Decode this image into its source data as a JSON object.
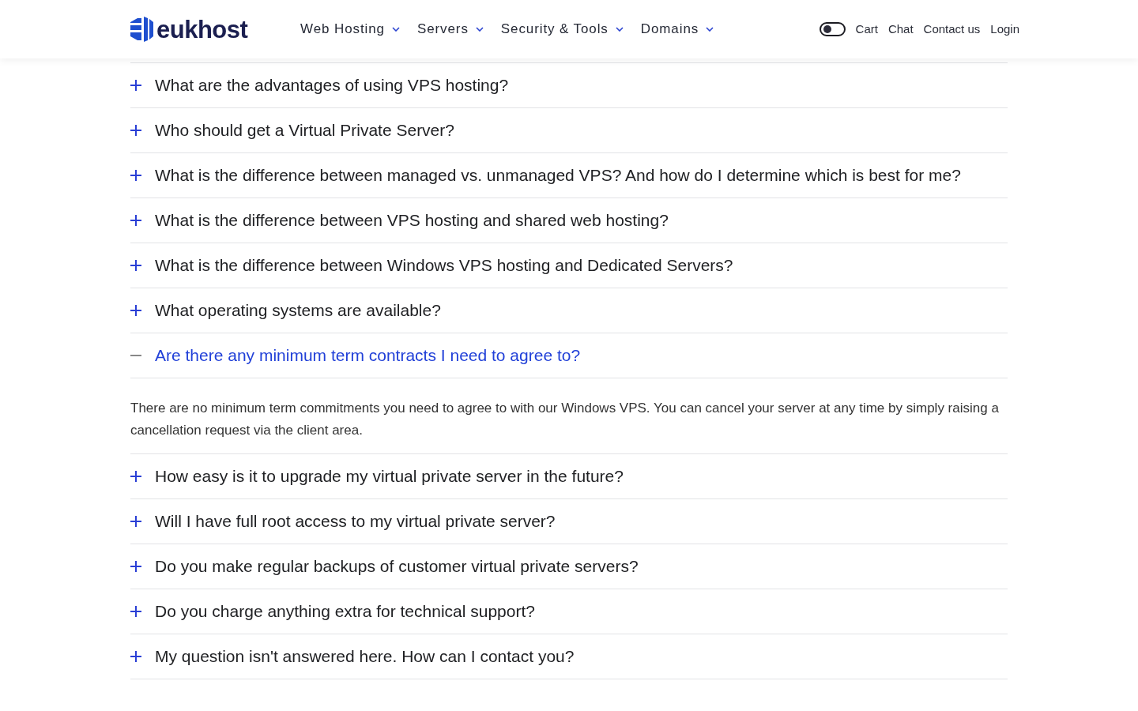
{
  "header": {
    "brand": "eukhost",
    "nav": [
      {
        "label": "Web Hosting"
      },
      {
        "label": "Servers"
      },
      {
        "label": "Security & Tools"
      },
      {
        "label": "Domains"
      }
    ],
    "theme_toggle": {
      "on": false
    },
    "links": [
      "Cart",
      "Chat",
      "Contact us",
      "Login"
    ]
  },
  "faq": [
    {
      "question": "What are the advantages of using VPS hosting?",
      "expanded": false
    },
    {
      "question": "Who should get a Virtual Private Server?",
      "expanded": false
    },
    {
      "question": "What is the difference between managed vs. unmanaged VPS? And how do I determine which is best for me?",
      "expanded": false
    },
    {
      "question": "What is the difference between VPS hosting and shared web hosting?",
      "expanded": false
    },
    {
      "question": "What is the difference between Windows VPS hosting and Dedicated Servers?",
      "expanded": false
    },
    {
      "question": "What operating systems are available?",
      "expanded": false
    },
    {
      "question": "Are there any minimum term contracts I need to agree to?",
      "expanded": true,
      "answer": "There are no minimum term commitments you need to agree to with our Windows VPS. You can cancel your server at any time by simply raising a cancellation request via the client area."
    },
    {
      "question": "How easy is it to upgrade my virtual private server in the future?",
      "expanded": false
    },
    {
      "question": "Will I have full root access to my virtual private server?",
      "expanded": false
    },
    {
      "question": "Do you make regular backups of customer virtual private servers?",
      "expanded": false
    },
    {
      "question": "Do you charge anything extra for technical support?",
      "expanded": false
    },
    {
      "question": "My question isn't answered here. How can I contact you?",
      "expanded": false
    }
  ]
}
